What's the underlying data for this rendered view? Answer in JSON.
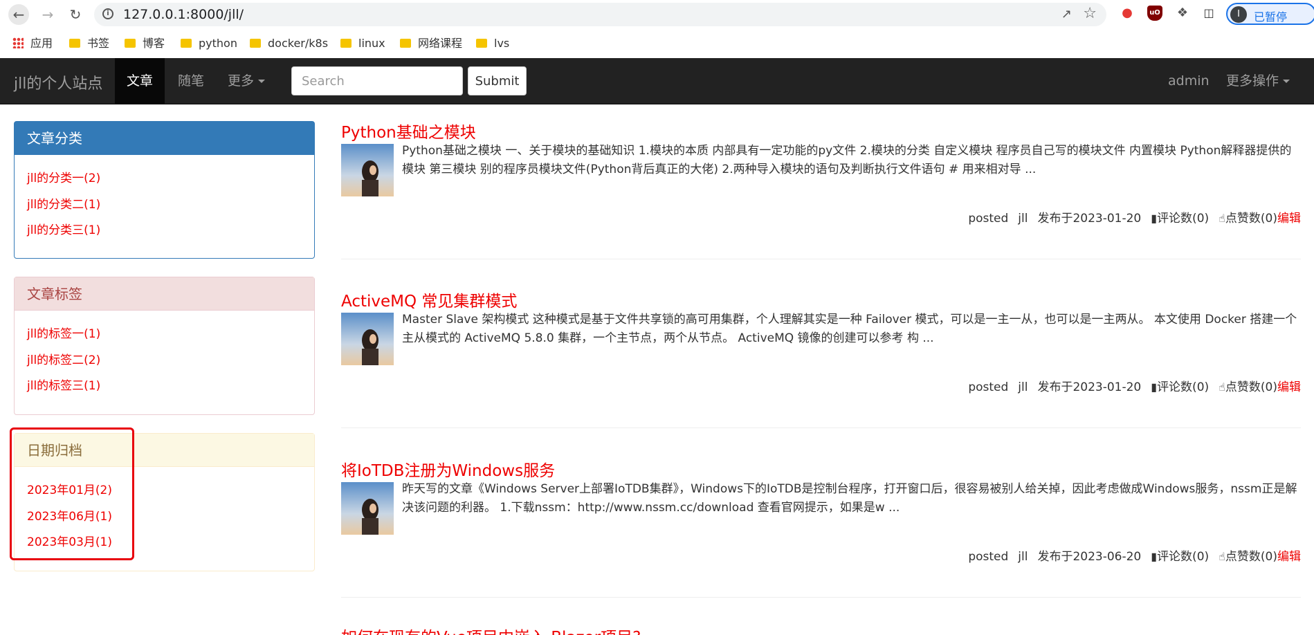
{
  "browser": {
    "url": "127.0.0.1:8000/jll/",
    "profile_label": "已暂停",
    "profile_initial": "I",
    "bookmarks": [
      "应用",
      "书签",
      "博客",
      "python",
      "docker/k8s",
      "linux",
      "网络课程",
      "lvs"
    ]
  },
  "navbar": {
    "brand": "jll的个人站点",
    "items": [
      "文章",
      "随笔",
      "更多"
    ],
    "search_placeholder": "Search",
    "submit_label": "Submit",
    "user": "admin",
    "more_actions": "更多操作"
  },
  "sidebar": {
    "categories": {
      "title": "文章分类",
      "items": [
        "jll的分类一(2)",
        "jll的分类二(1)",
        "jll的分类三(1)"
      ]
    },
    "tags": {
      "title": "文章标签",
      "items": [
        "jll的标签一(1)",
        "jll的标签二(2)",
        "jll的标签三(1)"
      ]
    },
    "archive": {
      "title": "日期归档",
      "items": [
        "2023年01月(2)",
        "2023年06月(1)",
        "2023年03月(1)"
      ]
    }
  },
  "articles": [
    {
      "title": "Python基础之模块",
      "desc": "Python基础之模块 一、关于模块的基础知识 1.模块的本质 内部具有一定功能的py文件 2.模块的分类 自定义模块 程序员自己写的模块文件 内置模块 Python解释器提供的模块 第三模块 别的程序员模块文件(Python背后真正的大佬) 2.两种导入模块的语句及判断执行文件语句 # 用来相对导 ...",
      "posted": "posted",
      "author": "jll",
      "date": "发布于2023-01-20",
      "comments": "评论数(0)",
      "likes": "点赞数(0)",
      "edit": "编辑"
    },
    {
      "title": "ActiveMQ 常见集群模式",
      "desc": "Master Slave 架构模式 这种模式是基于文件共享锁的高可用集群，个人理解其实是一种 Failover 模式，可以是一主一从，也可以是一主两从。 本文使用 Docker 搭建一个主从模式的 ActiveMQ 5.8.0 集群，一个主节点，两个从节点。 ActiveMQ 镜像的创建可以参考 构 ...",
      "posted": "posted",
      "author": "jll",
      "date": "发布于2023-01-20",
      "comments": "评论数(0)",
      "likes": "点赞数(0)",
      "edit": "编辑"
    },
    {
      "title": "将IoTDB注册为Windows服务",
      "desc": "昨天写的文章《Windows Server上部署IoTDB集群》，Windows下的IoTDB是控制台程序，打开窗口后，很容易被别人给关掉，因此考虑做成Windows服务，nssm正是解决该问题的利器。 1.下载nssm：http://www.nssm.cc/download 查看官网提示，如果是w ...",
      "posted": "posted",
      "author": "jll",
      "date": "发布于2023-06-20",
      "comments": "评论数(0)",
      "likes": "点赞数(0)",
      "edit": "编辑"
    },
    {
      "title": "如何在现有的Vue项目中嵌入 Blazor项目?"
    }
  ]
}
